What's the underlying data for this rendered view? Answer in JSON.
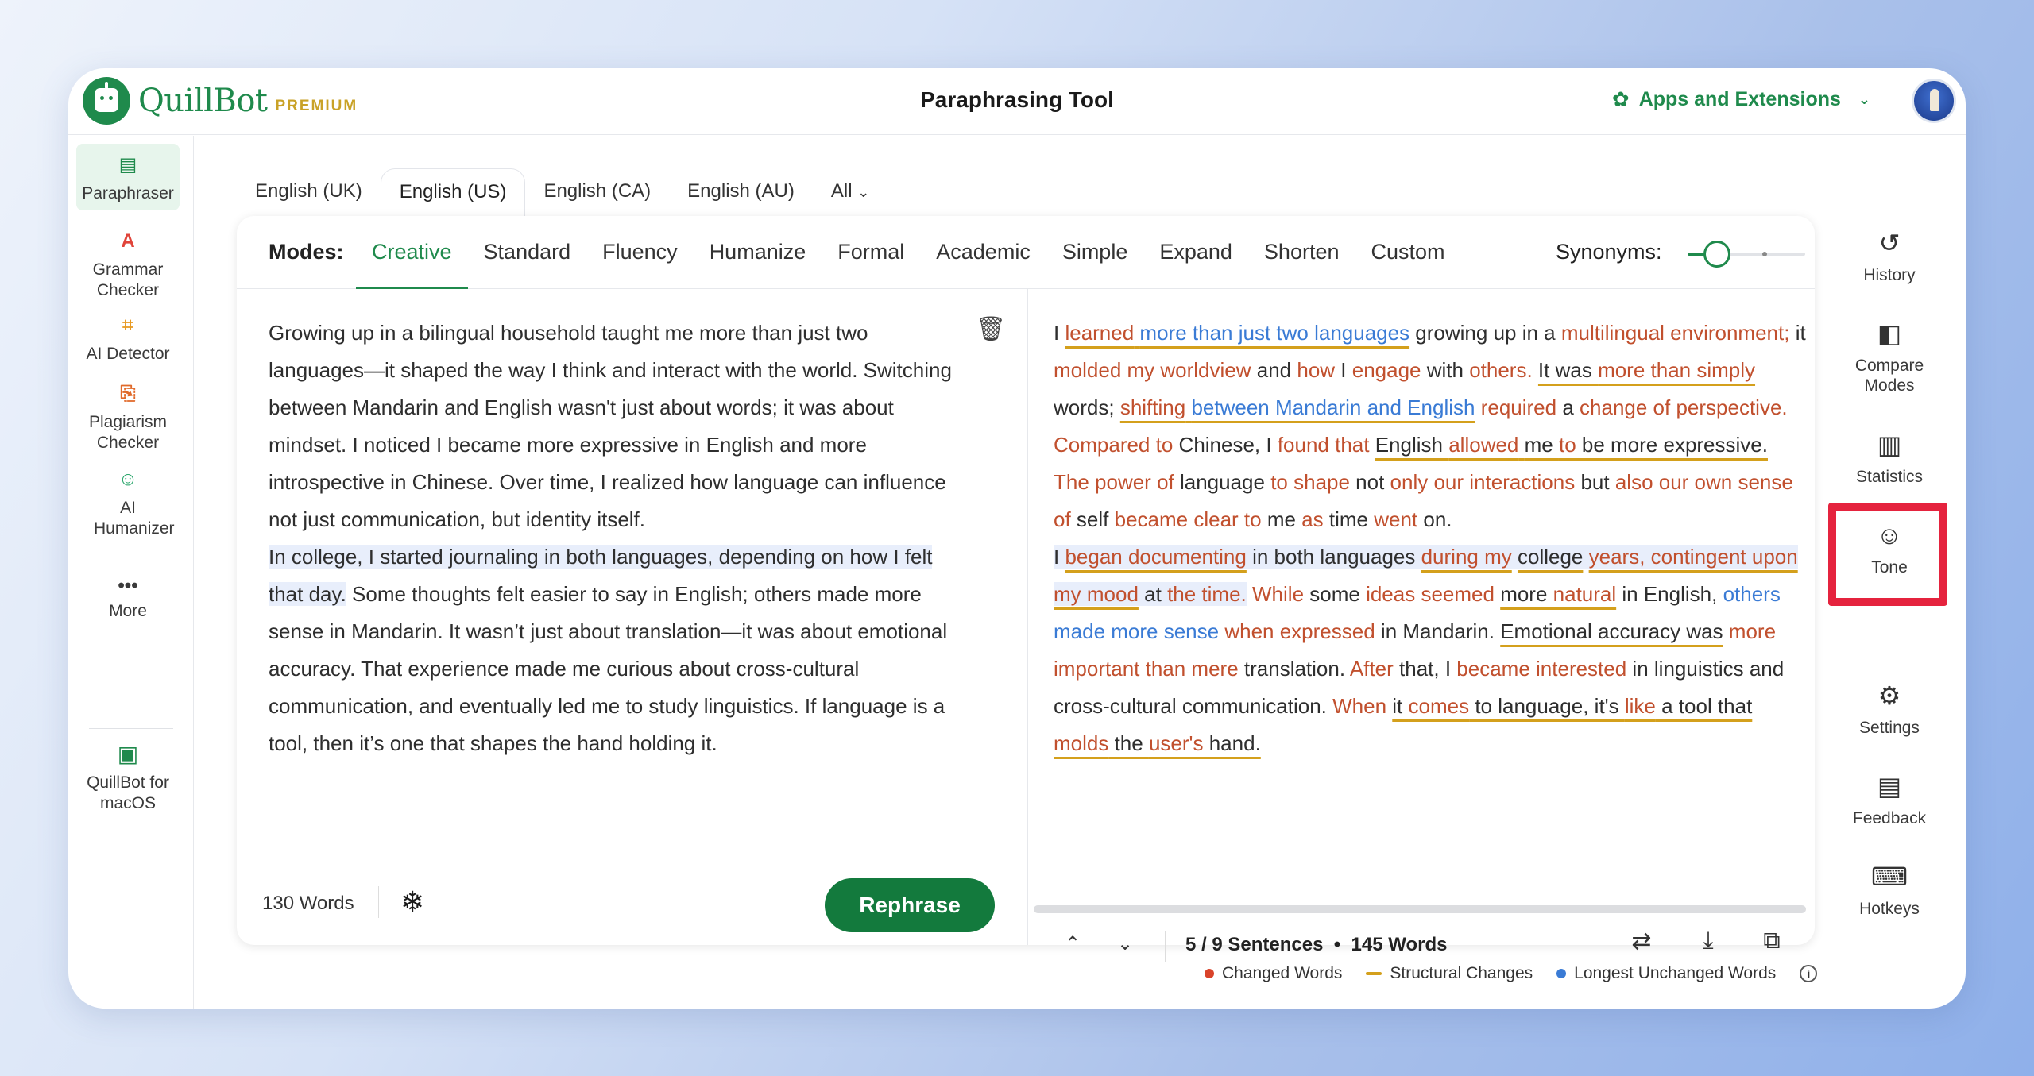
{
  "header": {
    "brand": "QuillBot",
    "premium": "PREMIUM",
    "title": "Paraphrasing Tool",
    "apps_label": "Apps and Extensions"
  },
  "left_sidebar": {
    "paraphraser": "Paraphraser",
    "grammar": "Grammar Checker",
    "ai_detector": "AI Detector",
    "plagiarism": "Plagiarism Checker",
    "humanizer": "AI Humanizer",
    "more": "More",
    "macos": "QuillBot for macOS"
  },
  "language_tabs": [
    "English (UK)",
    "English (US)",
    "English (CA)",
    "English (AU)",
    "All"
  ],
  "active_language": "English (US)",
  "modes": {
    "label": "Modes:",
    "items": [
      "Creative",
      "Standard",
      "Fluency",
      "Humanize",
      "Formal",
      "Academic",
      "Simple",
      "Expand",
      "Shorten",
      "Custom"
    ],
    "active": "Creative"
  },
  "synonyms": {
    "label": "Synonyms:",
    "level": 0.25
  },
  "input": {
    "para1": "Growing up in a bilingual household taught me more than just two languages—it shaped the way I think and interact with the world. Switching between Mandarin and English wasn't just about words; it was about mindset. I noticed I became more expressive in English and more introspective in Chinese. Over time, I realized how language can influence not just communication, but identity itself.",
    "highlight": "In college, I started journaling in both languages, depending on how I felt that day.",
    "para2_rest": " Some thoughts felt easier to say in English; others made more sense in Mandarin. It wasn’t just about translation—it was about emotional accuracy. That experience made me curious about cross-cultural communication, and eventually led me to study linguistics. If language is a tool, then it’s one that shapes the hand holding it.",
    "word_count": "130 Words",
    "rephrase_label": "Rephrase"
  },
  "output": {
    "p1": [
      {
        "t": "I ",
        "k": "n"
      },
      {
        "t": "learned",
        "k": "cs"
      },
      {
        "t": " ",
        "k": "s"
      },
      {
        "t": "more than just two languages",
        "k": "ls"
      },
      {
        "t": " growing up in a ",
        "k": "n"
      },
      {
        "t": "multilingual environment;",
        "k": "c"
      },
      {
        "t": " it ",
        "k": "n"
      },
      {
        "t": "molded my worldview",
        "k": "c"
      },
      {
        "t": " and ",
        "k": "n"
      },
      {
        "t": "how",
        "k": "c"
      },
      {
        "t": " I ",
        "k": "n"
      },
      {
        "t": "engage",
        "k": "c"
      },
      {
        "t": " with ",
        "k": "n"
      },
      {
        "t": "others.",
        "k": "c"
      },
      {
        "t": " ",
        "k": "n"
      },
      {
        "t": "It was ",
        "k": "s"
      },
      {
        "t": "more than simply",
        "k": "cs"
      },
      {
        "t": " words;",
        "k": "n"
      },
      {
        "t": " ",
        "k": "n"
      },
      {
        "t": "shifting",
        "k": "cs"
      },
      {
        "t": " ",
        "k": "s"
      },
      {
        "t": "between Mandarin and English",
        "k": "ls"
      },
      {
        "t": " ",
        "k": "n"
      },
      {
        "t": "required",
        "k": "c"
      },
      {
        "t": " a ",
        "k": "n"
      },
      {
        "t": "change of perspective.",
        "k": "c"
      },
      {
        "t": " ",
        "k": "n"
      },
      {
        "t": "Compared to",
        "k": "c"
      },
      {
        "t": " Chinese, I ",
        "k": "n"
      },
      {
        "t": "found that",
        "k": "c"
      },
      {
        "t": " ",
        "k": "n"
      },
      {
        "t": "English ",
        "k": "s"
      },
      {
        "t": "allowed",
        "k": "cs"
      },
      {
        "t": " ",
        "k": "s"
      },
      {
        "t": "me ",
        "k": "s"
      },
      {
        "t": "to",
        "k": "cs"
      },
      {
        "t": " be more expressive.",
        "k": "s"
      },
      {
        "t": " ",
        "k": "n"
      },
      {
        "t": "The power of",
        "k": "c"
      },
      {
        "t": " language ",
        "k": "n"
      },
      {
        "t": "to shape",
        "k": "c"
      },
      {
        "t": " not ",
        "k": "n"
      },
      {
        "t": "only our interactions",
        "k": "c"
      },
      {
        "t": " but ",
        "k": "n"
      },
      {
        "t": "also our own sense of",
        "k": "c"
      },
      {
        "t": " self ",
        "k": "n"
      },
      {
        "t": "became clear to",
        "k": "c"
      },
      {
        "t": " me ",
        "k": "n"
      },
      {
        "t": "as",
        "k": "c"
      },
      {
        "t": " time ",
        "k": "n"
      },
      {
        "t": "went",
        "k": "c"
      },
      {
        "t": " on.",
        "k": "n"
      }
    ],
    "p2": [
      {
        "t": "I ",
        "k": "h"
      },
      {
        "t": "began documenting",
        "k": "hcs"
      },
      {
        "t": " in both languages ",
        "k": "h"
      },
      {
        "t": "during my",
        "k": "hcs"
      },
      {
        "t": " ",
        "k": "h"
      },
      {
        "t": "college",
        "k": "hs"
      },
      {
        "t": " ",
        "k": "h"
      },
      {
        "t": "years, contingent upon my mood",
        "k": "hcs"
      },
      {
        "t": " at ",
        "k": "h"
      },
      {
        "t": "the time.",
        "k": "hc"
      },
      {
        "t": " ",
        "k": "n"
      },
      {
        "t": "While",
        "k": "c"
      },
      {
        "t": " some ",
        "k": "n"
      },
      {
        "t": "ideas seemed",
        "k": "c"
      },
      {
        "t": " ",
        "k": "n"
      },
      {
        "t": "more ",
        "k": "s"
      },
      {
        "t": "natural",
        "k": "cs"
      },
      {
        "t": " in English, ",
        "k": "n"
      },
      {
        "t": "others made more sense",
        "k": "l"
      },
      {
        "t": " ",
        "k": "n"
      },
      {
        "t": "when expressed",
        "k": "c"
      },
      {
        "t": " in Mandarin. ",
        "k": "n"
      },
      {
        "t": "Emotional accuracy was",
        "k": "s"
      },
      {
        "t": " ",
        "k": "n"
      },
      {
        "t": "more important than mere",
        "k": "c"
      },
      {
        "t": " translation. ",
        "k": "n"
      },
      {
        "t": "After",
        "k": "c"
      },
      {
        "t": " that, I ",
        "k": "n"
      },
      {
        "t": "became interested",
        "k": "c"
      },
      {
        "t": " in linguistics and cross-cultural communication. ",
        "k": "n"
      },
      {
        "t": "When",
        "k": "c"
      },
      {
        "t": " ",
        "k": "n"
      },
      {
        "t": "it ",
        "k": "s"
      },
      {
        "t": "comes",
        "k": "cs"
      },
      {
        "t": " ",
        "k": "s"
      },
      {
        "t": "to language, it's ",
        "k": "s"
      },
      {
        "t": "like",
        "k": "cs"
      },
      {
        "t": " a tool that ",
        "k": "s"
      },
      {
        "t": "molds",
        "k": "cs"
      },
      {
        "t": " the ",
        "k": "s"
      },
      {
        "t": "user's",
        "k": "cs"
      },
      {
        "t": " hand.",
        "k": "s"
      }
    ],
    "sentences": "5 / 9 Sentences",
    "word_count": "145 Words"
  },
  "right_sidebar": {
    "history": "History",
    "compare": "Compare Modes",
    "statistics": "Statistics",
    "tone": "Tone",
    "settings": "Settings",
    "feedback": "Feedback",
    "hotkeys": "Hotkeys"
  },
  "legend": {
    "changed": "Changed Words",
    "structural": "Structural Changes",
    "unchanged": "Longest Unchanged Words"
  },
  "colors": {
    "brand_green": "#1f8a4c",
    "changed": "#c1502e",
    "structural": "#d4a01c",
    "unchanged": "#3a7bd5",
    "highlight_box": "#e5233e"
  }
}
